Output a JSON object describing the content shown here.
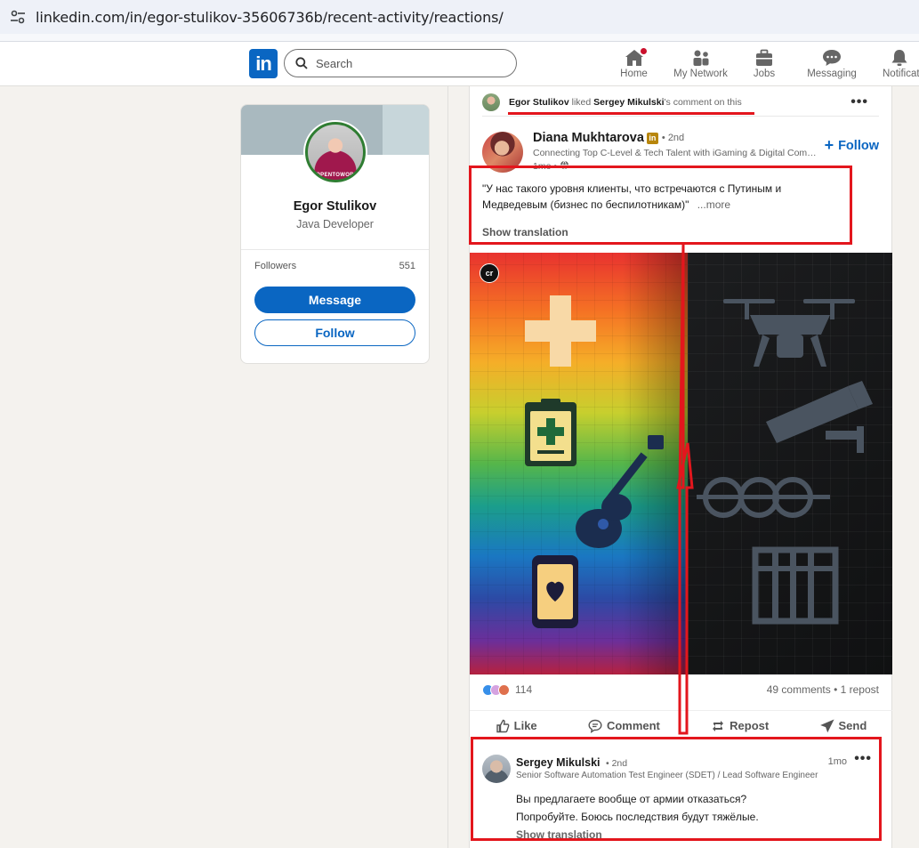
{
  "browser": {
    "url": "linkedin.com/in/egor-stulikov-35606736b/recent-activity/reactions/"
  },
  "nav": {
    "logo": "in",
    "search_placeholder": "Search",
    "items": [
      {
        "label": "Home",
        "icon": "home-icon"
      },
      {
        "label": "My Network",
        "icon": "network-icon"
      },
      {
        "label": "Jobs",
        "icon": "jobs-icon"
      },
      {
        "label": "Messaging",
        "icon": "messaging-icon"
      },
      {
        "label": "Notifications",
        "icon": "bell-icon"
      }
    ]
  },
  "profile": {
    "name": "Egor Stulikov",
    "title": "Java Developer",
    "avatar_badge": "#OPENTOWORK",
    "followers_label": "Followers",
    "followers_count": "551",
    "message_label": "Message",
    "follow_label": "Follow"
  },
  "post": {
    "activity": {
      "actor": "Egor Stulikov",
      "verb": "liked",
      "target": "Sergey Mikulski",
      "suffix": "'s comment on this"
    },
    "author": {
      "name": "Diana Mukhtarova",
      "degree": "• 2nd",
      "headline": "Connecting Top C-Level & Tech Talent with iGaming & Digital Companies",
      "time": "1mo •"
    },
    "follow_label": "Follow",
    "text": "\"У нас такого уровня клиенты, что встречаются с Путиным и Медведевым (бизнес по беспилотникам)\"",
    "more_label": "...more",
    "show_translation": "Show translation",
    "image_badge": "cr",
    "reactions_count": "114",
    "comments_reposts": "49 comments • 1 repost",
    "actions": {
      "like": "Like",
      "comment": "Comment",
      "repost": "Repost",
      "send": "Send"
    }
  },
  "comment": {
    "name": "Sergey Mikulski",
    "degree": "• 2nd",
    "headline": "Senior Software Automation Test Engineer (SDET) / Lead Software Engineer",
    "time": "1mo",
    "line1": "Вы предлагаете вообще от армии отказаться?",
    "line2": "Попробуйте. Боюсь последствия будут тяжёлые.",
    "show_translation": "Show translation"
  },
  "colors": {
    "brand": "#0a66c2",
    "annotation": "#e3161d",
    "notification_dot": "#cb112d"
  }
}
